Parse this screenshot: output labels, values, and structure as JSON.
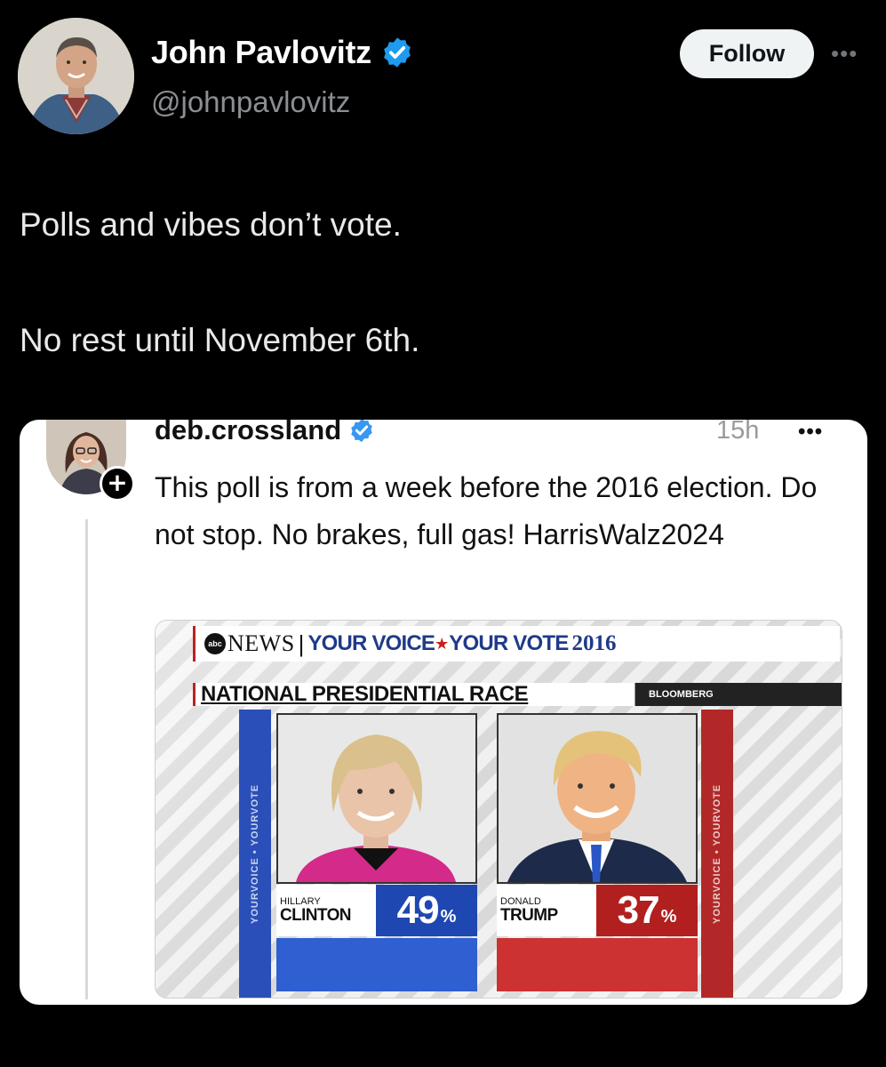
{
  "tweet": {
    "author_name": "John Pavlovitz",
    "author_handle": "@johnpavlovitz",
    "follow_label": "Follow",
    "text_lines": [
      "Polls and vibes don’t vote.",
      "No rest until November 6th."
    ]
  },
  "quoted_post": {
    "username": "deb.crossland",
    "time": "15h",
    "text": "This poll is from a week before the 2016 election. Do not stop. No brakes, full gas! HarrisWalz2024"
  },
  "poll_graphic": {
    "news_brand": "NEWS",
    "separator": "|",
    "tagline_part1": "YOUR VOICE",
    "tagline_part2": "YOUR VOTE",
    "year": "2016",
    "race_title": "NATIONAL PRESIDENTIAL RACE",
    "source": "BLOOMBERG",
    "side_text": "YOURVOICE • YOURVOTE",
    "candidates": [
      {
        "first": "HILLARY",
        "last": "CLINTON",
        "pct": "49",
        "pct_sign": "%",
        "color": "#1f47b2"
      },
      {
        "first": "DONALD",
        "last": "TRUMP",
        "pct": "37",
        "pct_sign": "%",
        "color": "#b21f1f"
      }
    ]
  },
  "colors": {
    "background": "#000000",
    "verified": "#1d9bf0",
    "democrat_blue": "#1f47b2",
    "republican_red": "#b21f1f"
  },
  "icons": [
    "verified-badge-icon",
    "more-options-icon",
    "plus-follow-icon",
    "abc-logo-icon",
    "star-icon"
  ]
}
